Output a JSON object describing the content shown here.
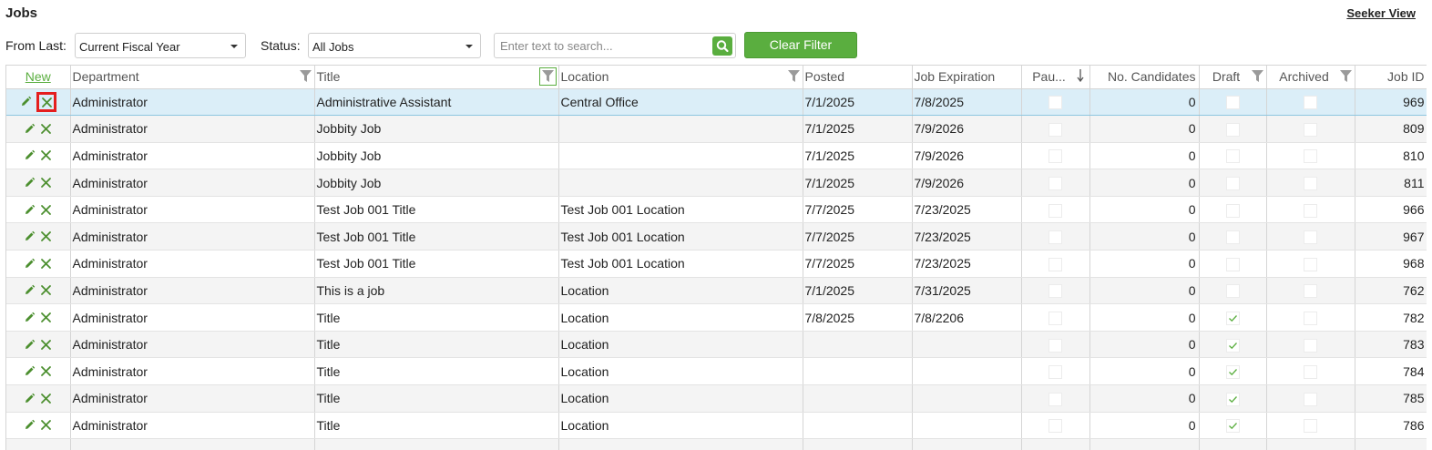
{
  "header": {
    "title": "Jobs",
    "seeker_view": "Seeker View"
  },
  "filters": {
    "from_last_label": "From Last:",
    "from_last_value": "Current Fiscal Year",
    "status_label": "Status:",
    "status_value": "All Jobs",
    "search_placeholder": "Enter text to search...",
    "clear_label": "Clear Filter"
  },
  "grid": {
    "columns": {
      "new": "New",
      "department": "Department",
      "title": "Title",
      "location": "Location",
      "posted": "Posted",
      "job_expiration": "Job Expiration",
      "paused": "Pau...",
      "candidates": "No. Candidates",
      "draft": "Draft",
      "archived": "Archived",
      "job_id": "Job ID"
    },
    "rows": [
      {
        "department": "Administrator",
        "title": "Administrative Assistant",
        "location": "Central Office",
        "posted": "7/1/2025",
        "expiration": "7/8/2025",
        "paused": false,
        "candidates": "0",
        "draft": false,
        "archived": false,
        "job_id": "969"
      },
      {
        "department": "Administrator",
        "title": "Jobbity Job",
        "location": "",
        "posted": "7/1/2025",
        "expiration": "7/9/2026",
        "paused": false,
        "candidates": "0",
        "draft": false,
        "archived": false,
        "job_id": "809"
      },
      {
        "department": "Administrator",
        "title": "Jobbity Job",
        "location": "",
        "posted": "7/1/2025",
        "expiration": "7/9/2026",
        "paused": false,
        "candidates": "0",
        "draft": false,
        "archived": false,
        "job_id": "810"
      },
      {
        "department": "Administrator",
        "title": "Jobbity Job",
        "location": "",
        "posted": "7/1/2025",
        "expiration": "7/9/2026",
        "paused": false,
        "candidates": "0",
        "draft": false,
        "archived": false,
        "job_id": "811"
      },
      {
        "department": "Administrator",
        "title": "Test Job 001 Title",
        "location": "Test Job 001 Location",
        "posted": "7/7/2025",
        "expiration": "7/23/2025",
        "paused": false,
        "candidates": "0",
        "draft": false,
        "archived": false,
        "job_id": "966"
      },
      {
        "department": "Administrator",
        "title": "Test Job 001 Title",
        "location": "Test Job 001 Location",
        "posted": "7/7/2025",
        "expiration": "7/23/2025",
        "paused": false,
        "candidates": "0",
        "draft": false,
        "archived": false,
        "job_id": "967"
      },
      {
        "department": "Administrator",
        "title": "Test Job 001 Title",
        "location": "Test Job 001 Location",
        "posted": "7/7/2025",
        "expiration": "7/23/2025",
        "paused": false,
        "candidates": "0",
        "draft": false,
        "archived": false,
        "job_id": "968"
      },
      {
        "department": "Administrator",
        "title": "This is a job",
        "location": "Location",
        "posted": "7/1/2025",
        "expiration": "7/31/2025",
        "paused": false,
        "candidates": "0",
        "draft": false,
        "archived": false,
        "job_id": "762"
      },
      {
        "department": "Administrator",
        "title": "Title",
        "location": "Location",
        "posted": "7/8/2025",
        "expiration": "7/8/2206",
        "paused": false,
        "candidates": "0",
        "draft": true,
        "archived": false,
        "job_id": "782"
      },
      {
        "department": "Administrator",
        "title": "Title",
        "location": "Location",
        "posted": "",
        "expiration": "",
        "paused": false,
        "candidates": "0",
        "draft": true,
        "archived": false,
        "job_id": "783"
      },
      {
        "department": "Administrator",
        "title": "Title",
        "location": "Location",
        "posted": "",
        "expiration": "",
        "paused": false,
        "candidates": "0",
        "draft": true,
        "archived": false,
        "job_id": "784"
      },
      {
        "department": "Administrator",
        "title": "Title",
        "location": "Location",
        "posted": "",
        "expiration": "",
        "paused": false,
        "candidates": "0",
        "draft": true,
        "archived": false,
        "job_id": "785"
      },
      {
        "department": "Administrator",
        "title": "Title",
        "location": "Location",
        "posted": "",
        "expiration": "",
        "paused": false,
        "candidates": "0",
        "draft": true,
        "archived": false,
        "job_id": "786"
      }
    ]
  },
  "colors": {
    "accent": "#5aae3f",
    "selected_row": "#dbeef8",
    "highlight_box": "#e41e1e"
  },
  "icons": {
    "edit": "pencil-icon",
    "delete": "close-icon",
    "filter": "filter-icon",
    "search": "search-icon",
    "sort": "arrow-down-icon",
    "check": "checkmark-icon"
  }
}
